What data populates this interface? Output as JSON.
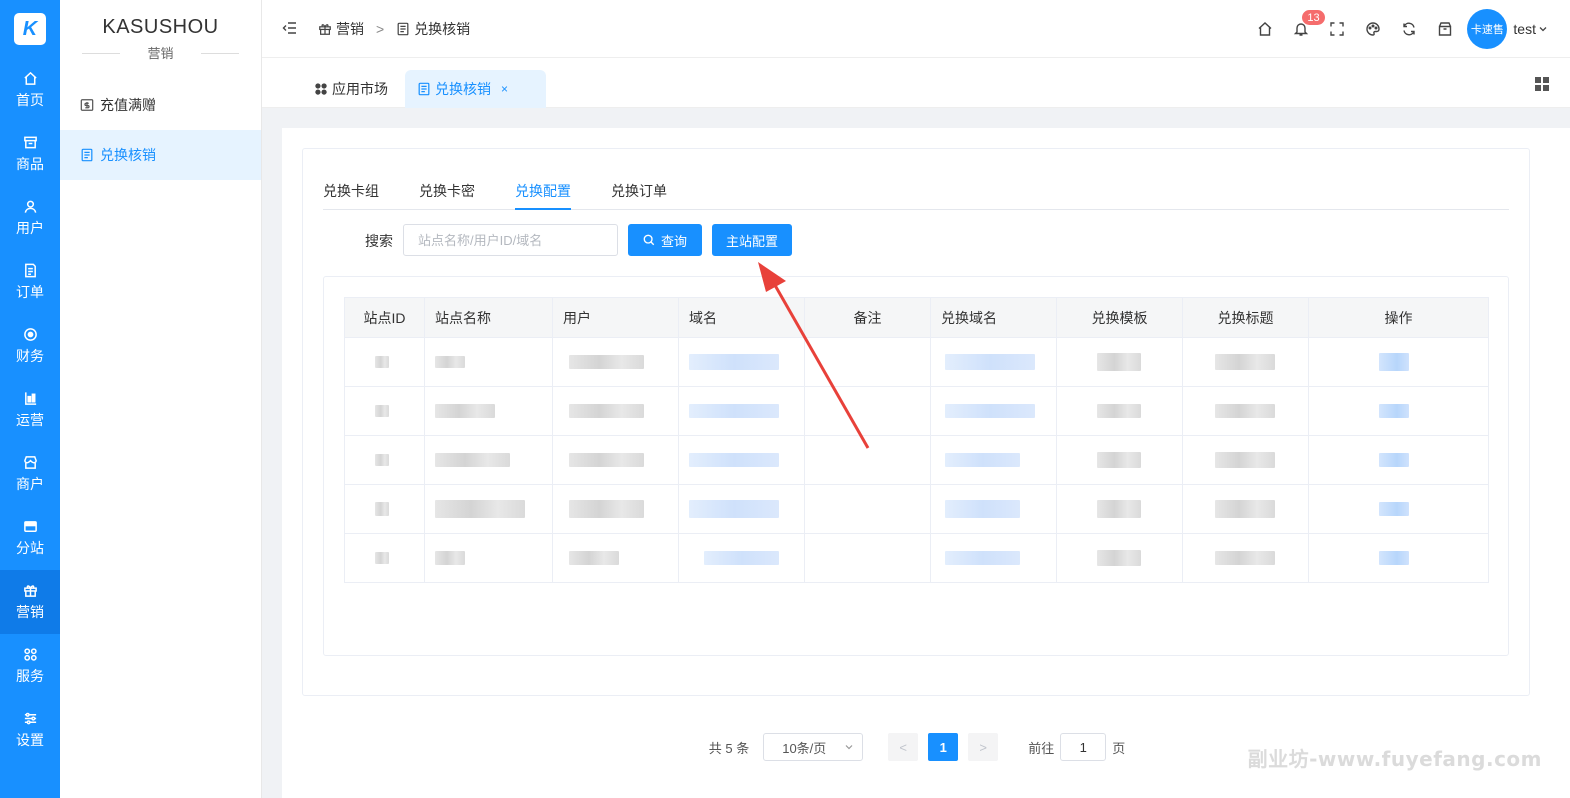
{
  "brand": {
    "logo_text": "K",
    "app_name": "KASUSHOU",
    "section": "营销"
  },
  "rail": [
    {
      "label": "首页",
      "icon": "home-icon"
    },
    {
      "label": "商品",
      "icon": "box-icon"
    },
    {
      "label": "用户",
      "icon": "user-icon"
    },
    {
      "label": "订单",
      "icon": "order-icon"
    },
    {
      "label": "财务",
      "icon": "finance-icon"
    },
    {
      "label": "运营",
      "icon": "operation-icon"
    },
    {
      "label": "商户",
      "icon": "merchant-icon"
    },
    {
      "label": "分站",
      "icon": "substation-icon"
    },
    {
      "label": "营销",
      "icon": "gift-icon",
      "active": true
    },
    {
      "label": "服务",
      "icon": "service-icon"
    },
    {
      "label": "设置",
      "icon": "settings-icon"
    }
  ],
  "submenu": [
    {
      "label": "充值满赠",
      "icon": "recharge-icon"
    },
    {
      "label": "兑换核销",
      "icon": "document-icon",
      "active": true
    }
  ],
  "header": {
    "breadcrumb": [
      "营销",
      "兑换核销"
    ],
    "breadcrumb_sep": ">",
    "notification_count": "13",
    "avatar_text": "卡速售",
    "username": "test"
  },
  "page_tabs": [
    {
      "label": "应用市场",
      "icon": "apps-icon"
    },
    {
      "label": "兑换核销",
      "icon": "document-icon",
      "active": true,
      "close": "×"
    }
  ],
  "inner_tabs": [
    "兑换卡组",
    "兑换卡密",
    "兑换配置",
    "兑换订单"
  ],
  "active_inner_tab": "兑换配置",
  "search": {
    "label": "搜索",
    "placeholder": "站点名称/用户ID/域名",
    "query_button": "查询",
    "main_config_button": "主站配置"
  },
  "table": {
    "columns": [
      "站点ID",
      "站点名称",
      "用户",
      "域名",
      "备注",
      "兑换域名",
      "兑换模板",
      "兑换标题",
      "操作"
    ],
    "row_count": 5
  },
  "pagination": {
    "total": "共 5 条",
    "page_size": "10条/页",
    "current_page": "1",
    "goto_label": "前往",
    "goto_value": "1",
    "page_unit": "页",
    "prev": "<",
    "next": ">"
  },
  "watermark": "副业坊-www.fuyefang.com",
  "colors": {
    "primary": "#1890ff",
    "badge": "#f56c6c",
    "annotation_arrow": "#e8413a"
  }
}
